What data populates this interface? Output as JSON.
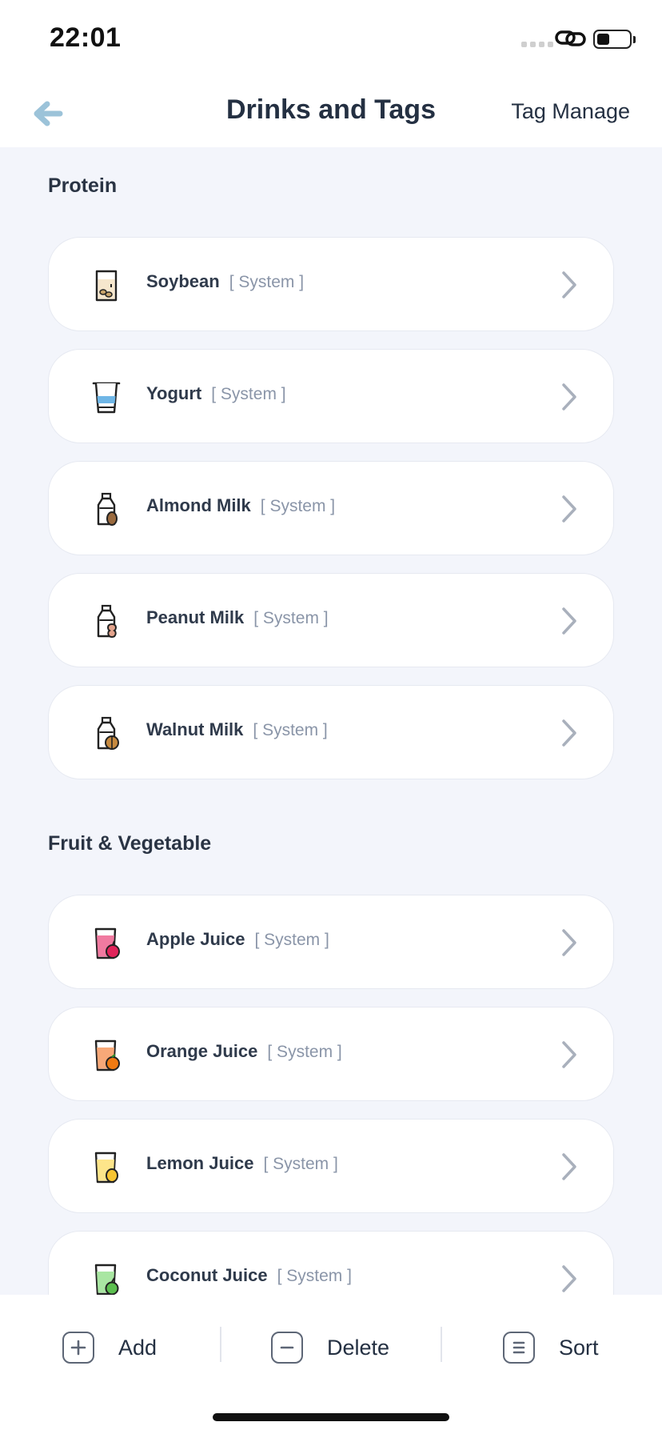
{
  "status": {
    "time": "22:01"
  },
  "header": {
    "title": "Drinks and Tags",
    "action_label": "Tag Manage"
  },
  "sections": [
    {
      "title": "Protein",
      "items": [
        {
          "name": "Soybean",
          "badge": "[ System ]",
          "icon": "soy-milk-glass-icon"
        },
        {
          "name": "Yogurt",
          "badge": "[ System ]",
          "icon": "yogurt-cup-icon"
        },
        {
          "name": "Almond Milk",
          "badge": "[ System ]",
          "icon": "almond-milk-bottle-icon"
        },
        {
          "name": "Peanut Milk",
          "badge": "[ System ]",
          "icon": "peanut-milk-bottle-icon"
        },
        {
          "name": "Walnut Milk",
          "badge": "[ System ]",
          "icon": "walnut-milk-bottle-icon"
        }
      ]
    },
    {
      "title": "Fruit & Vegetable",
      "items": [
        {
          "name": "Apple Juice",
          "badge": "[ System ]",
          "icon": "apple-juice-icon"
        },
        {
          "name": "Orange Juice",
          "badge": "[ System ]",
          "icon": "orange-juice-icon"
        },
        {
          "name": "Lemon Juice",
          "badge": "[ System ]",
          "icon": "lemon-juice-icon"
        },
        {
          "name": "Coconut Juice",
          "badge": "[ System ]",
          "icon": "coconut-juice-icon"
        }
      ]
    }
  ],
  "bottom_bar": {
    "add_label": "Add",
    "delete_label": "Delete",
    "sort_label": "Sort"
  },
  "colors": {
    "back_arrow": "#9cc3d9",
    "page_bg": "#f3f5fb",
    "card_bg": "#ffffff",
    "chevron": "#a9b0bc"
  }
}
